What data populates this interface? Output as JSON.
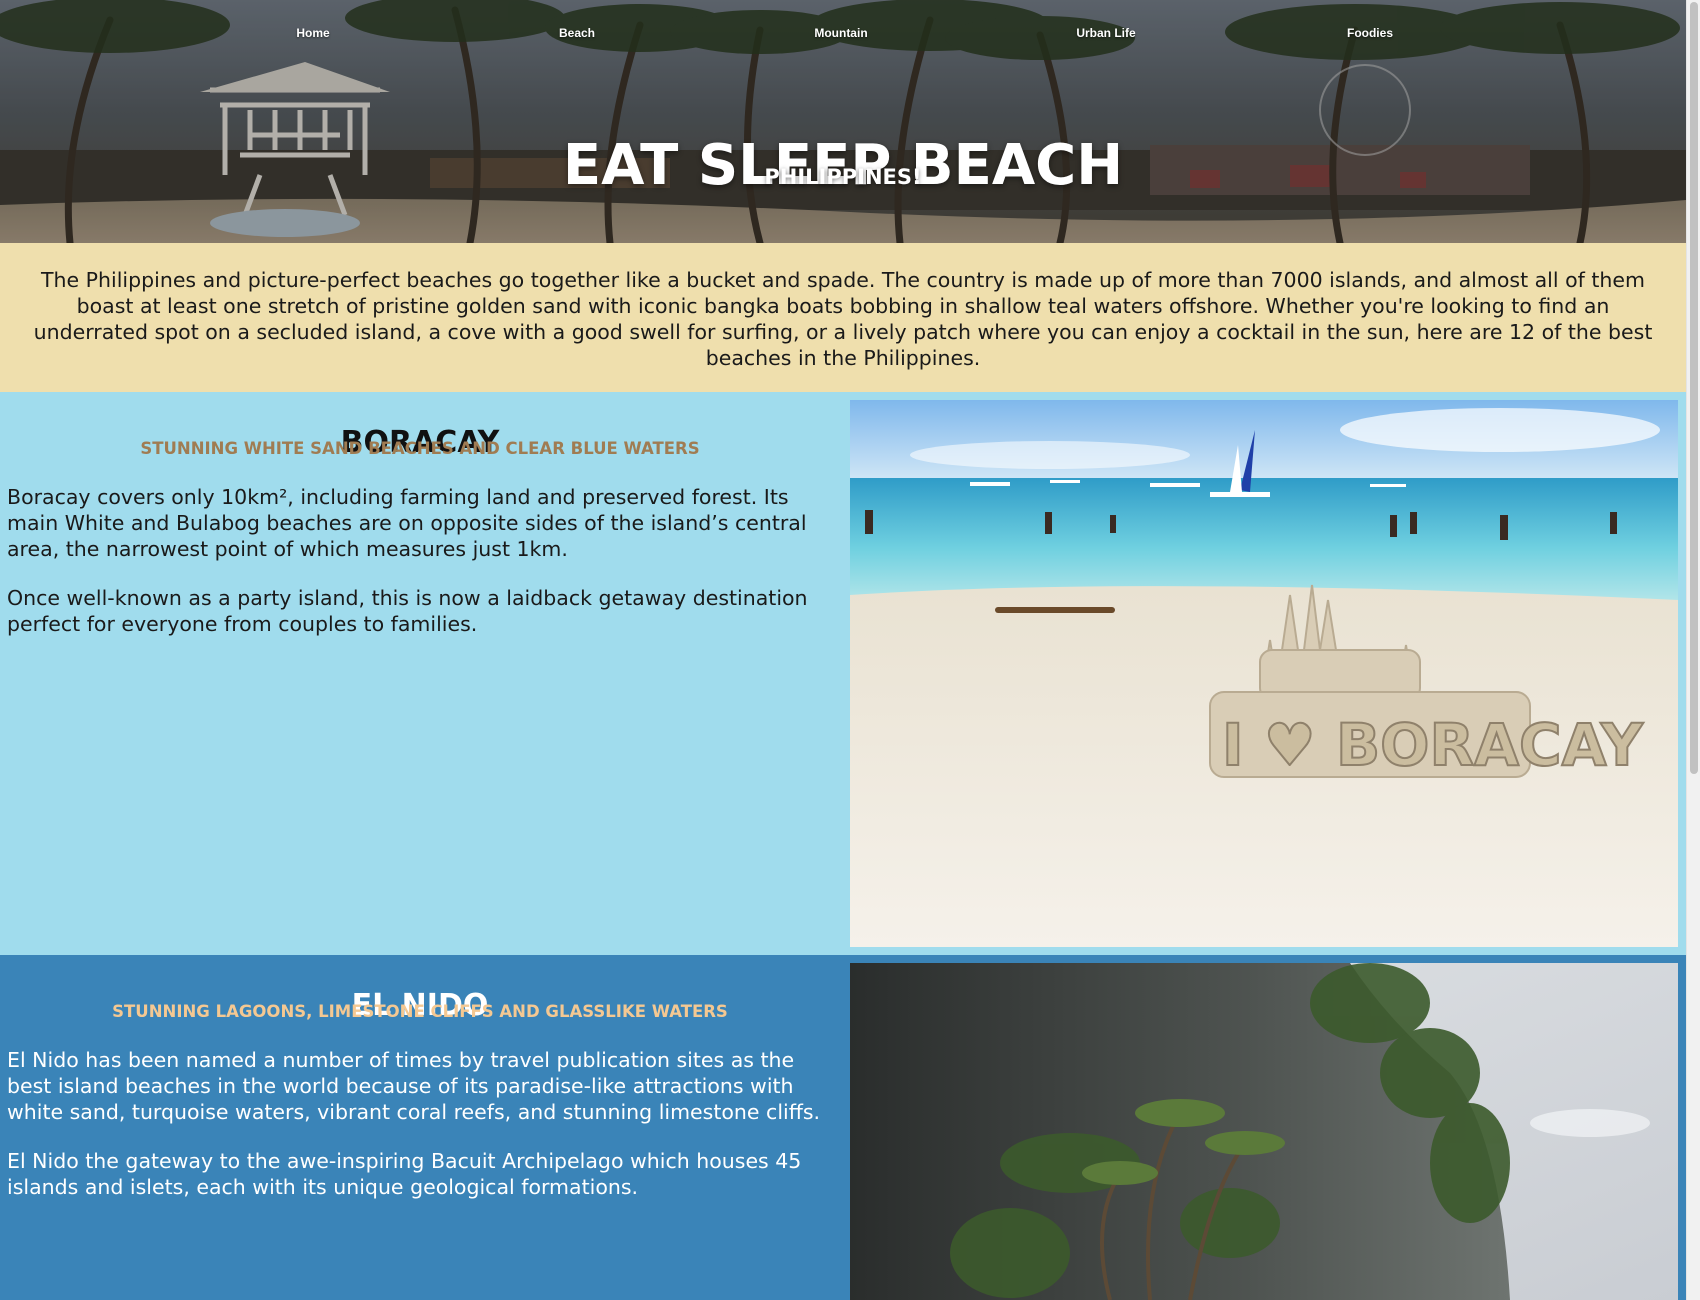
{
  "nav": {
    "items": [
      {
        "label": "Home"
      },
      {
        "label": "Beach"
      },
      {
        "label": "Mountain"
      },
      {
        "label": "Urban Life"
      },
      {
        "label": "Foodies"
      }
    ]
  },
  "hero": {
    "title": "EAT SLEEP BEACH",
    "subtitle": "PHILIPPINES!"
  },
  "intro": {
    "text": "The Philippines and picture-perfect beaches go together like a bucket and spade. The country is made up of more than 7000 islands, and almost all of them boast at least one stretch of pristine golden sand with iconic bangka boats bobbing in shallow teal waters offshore. Whether you're looking to find an underrated spot on a secluded island, a cove with a good swell for surfing, or a lively patch where you can enjoy a cocktail in the sun, here are 12 of the best beaches in the Philippines."
  },
  "sections": [
    {
      "title": "BORACAY",
      "tagline": "STUNNING WHITE SAND BEACHES AND CLEAR BLUE WATERS",
      "paragraphs": [
        "Boracay covers only 10km², including farming land and preserved forest. Its main White and Bulabog beaches are on opposite sides of the island’s central area, the narrowest point of which measures just 1km.",
        "Once well-known as a party island, this is now a laidback getaway destination perfect for everyone from couples to families."
      ],
      "image_text": "I ♥ BORACAY"
    },
    {
      "title": "EL NIDO",
      "tagline": "STUNNING LAGOONS, LIMESTONE CLIFFS AND GLASSLIKE WATERS",
      "paragraphs": [
        "El Nido has been named a number of times by travel publication sites as the best island beaches in the world because of its paradise-like attractions with white sand, turquoise waters, vibrant coral reefs, and stunning limestone cliffs.",
        "El Nido the gateway to the awe-inspiring Bacuit Archipelago which houses 45 islands and islets, each with its unique geological formations."
      ]
    }
  ],
  "colors": {
    "intro_bg": "#efdfad",
    "boracay_bg": "#a0dced",
    "boracay_tagline": "#a07c52",
    "elnido_bg": "#3a84b8",
    "elnido_tagline": "#f4c892"
  },
  "icons": {
    "hero_image": "beach-palm-trees-lifeguard-tower-image",
    "boracay_image": "sandcastle-beach-image",
    "elnido_image": "limestone-cliff-image"
  }
}
